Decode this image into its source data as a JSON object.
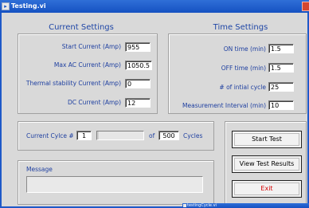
{
  "window": {
    "title": "Testing.vi"
  },
  "current_settings": {
    "header": "Current Settings",
    "fields": [
      {
        "label": "Start Current (Amp)",
        "value": "955"
      },
      {
        "label": "Max AC Current (Amp)",
        "value": "1050.5"
      },
      {
        "label": "Thermal stability Current (Amp)",
        "value": "0"
      },
      {
        "label": "DC Current (Amp)",
        "value": "12"
      }
    ]
  },
  "time_settings": {
    "header": "Time Settings",
    "fields": [
      {
        "label": "ON time (min)",
        "value": "1.5"
      },
      {
        "label": "OFF time (min)",
        "value": "1.5"
      },
      {
        "label": "# of intial cycle",
        "value": "25"
      },
      {
        "label": "Measurement Interval (min)",
        "value": "10"
      }
    ]
  },
  "cycle": {
    "label": "Current Cylce #",
    "current": "1",
    "of_label": "of",
    "total": "500",
    "unit_label": "Cycles",
    "progress_fraction": 0.002
  },
  "message": {
    "label": "Message",
    "value": ""
  },
  "buttons": {
    "start_test": "Start Test",
    "view_results": "View Test Results",
    "exit": "Exit"
  },
  "second_window": {
    "title": "testingCycle.vi"
  },
  "colors": {
    "titlebar": "#1551c2",
    "label_blue": "#1e3fa0",
    "exit_red": "#d40000"
  }
}
